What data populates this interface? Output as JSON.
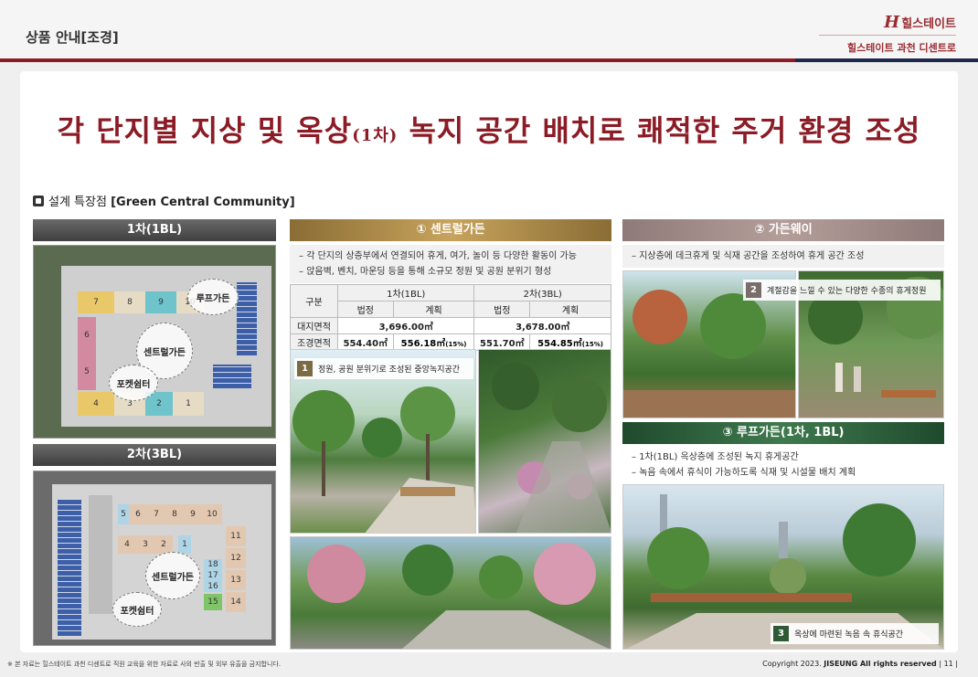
{
  "header": {
    "title": "상품 안내[조경]",
    "brand_mark": "H",
    "brand_name": "힐스테이트",
    "brand_sub": "힐스테이트 과천 디센트로"
  },
  "headline": {
    "part1": "각 단지별 지상 및 옥상",
    "part_small": "(1차)",
    "part2": " 녹지 공간 배치로 쾌적한 주거 환경 조성"
  },
  "feature": {
    "label": "설계 특장점 ",
    "title": "[Green Central Community]"
  },
  "left": {
    "map1_title": "1차(1BL)",
    "map2_title": "2차(3BL)",
    "map1_buildings": [
      "7",
      "8",
      "9",
      "10",
      "6",
      "5",
      "4",
      "3",
      "2",
      "1"
    ],
    "map1_labels": {
      "central": "센트럴가든",
      "roof": "루프가든",
      "pocket": "포켓쉼터"
    },
    "map2_buildings": [
      "5",
      "6",
      "7",
      "8",
      "9",
      "10",
      "4",
      "3",
      "2",
      "1",
      "11",
      "12",
      "13",
      "14",
      "18",
      "17",
      "16",
      "15"
    ],
    "map2_labels": {
      "central": "센트럴가든",
      "pocket": "포켓쉼터"
    }
  },
  "middle": {
    "title": "① 센트럴가든",
    "bullets": [
      "각 단지의 상층부에서 연결되어 휴게, 여가, 놀이 등 다양한 활동이 가능",
      "앉음벽, 벤치, 마운딩 등을 통해 소규모 정원 및 공원 분위기 형성"
    ],
    "table": {
      "col_label": "구분",
      "group1": "1차(1BL)",
      "group2": "2차(3BL)",
      "sub_legal": "법정",
      "sub_plan": "계획",
      "row1_label": "대지면적",
      "row1_v1": "3,696.00㎡",
      "row1_v2": "3,678.00㎡",
      "row2_label": "조경면적",
      "row2_legal1": "554.40㎡",
      "row2_plan1": "556.18㎡",
      "row2_pct1": "(15%)",
      "row2_legal2": "551.70㎡",
      "row2_plan2": "554.85㎡",
      "row2_pct2": "(15%)"
    },
    "caption_num": "1",
    "caption": "정원, 공원 분위기로 조성된 중앙녹지공간"
  },
  "right": {
    "title1": "② 가든웨이",
    "bullet1": "지상층에 데크휴게 및 식재 공간을 조성하여 휴게 공간 조성",
    "caption2_num": "2",
    "caption2": "계절감을 느낄 수 있는 다양한 수종의 휴게정원",
    "title2": "③ 루프가든(1차, 1BL)",
    "bullets2": [
      "1차(1BL) 옥상층에 조성된 녹지 휴게공간",
      "녹음 속에서 휴식이 가능하도록 식재 및 시설물 배치 계획"
    ],
    "caption3_num": "3",
    "caption3": "옥상에 마련된 녹음 속 휴식공간"
  },
  "footer": {
    "disclaimer": "※ 본 자료는 힐스테이트 과천 디센트로 직원 교육을 위한 자료로 사외 반출 및 외부 유출을 금지합니다.",
    "copyright_prefix": "Copyright 2023. ",
    "copyright_bold": "JISEUNG All rights reserved",
    "page": "  | 11 |"
  }
}
